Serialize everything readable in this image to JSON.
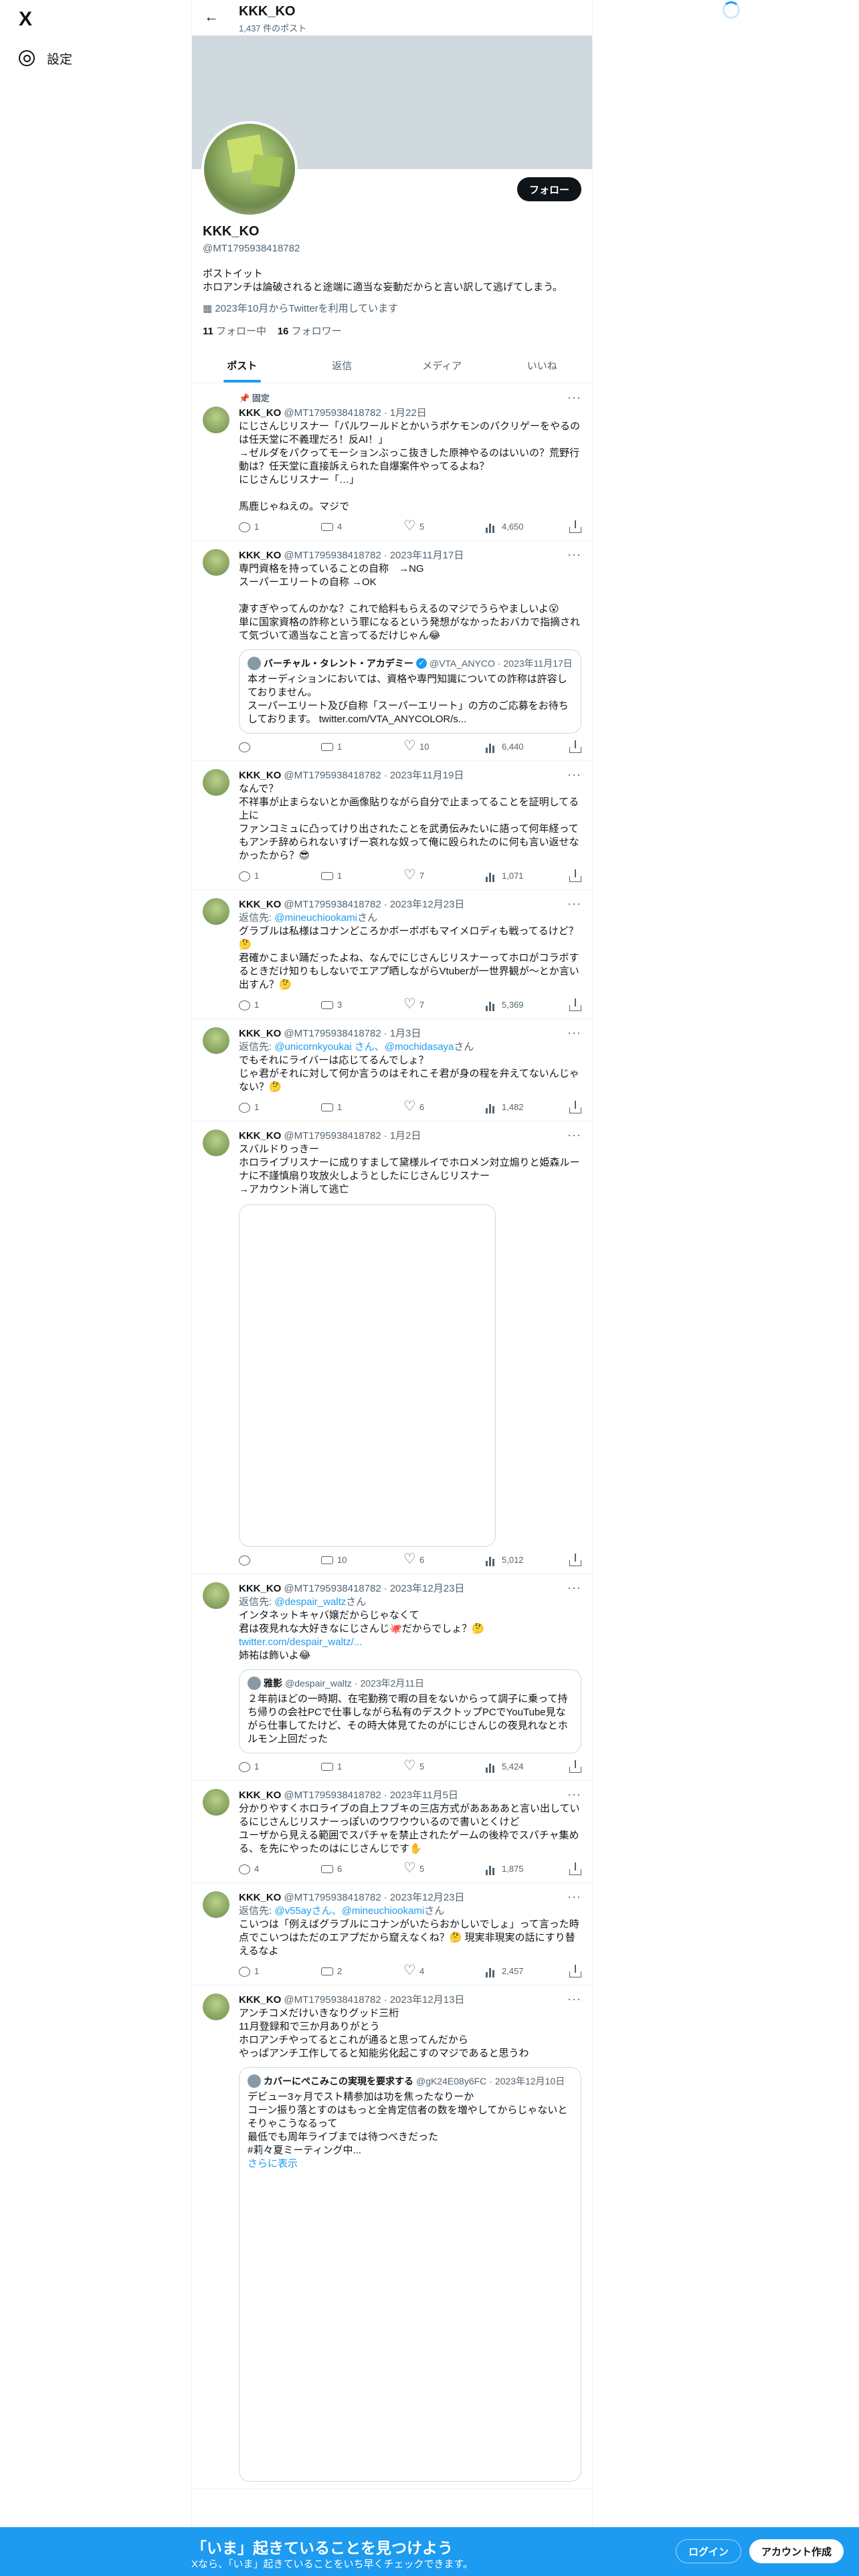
{
  "nav": {
    "logo": "X",
    "settings_label": "設定"
  },
  "header": {
    "name": "KKK_KO",
    "post_count": "1,437 件のポスト"
  },
  "profile": {
    "name": "KKK_KO",
    "handle": "@MT1795938418782",
    "follow_label": "フォロー",
    "bio": "ポストイット\nホロアンチは論破されると途端に適当な妄動だからと言い訳して逃げてしまう。",
    "joined": "2023年10月からTwitterを利用しています",
    "following_count": "11",
    "following_label": "フォロー中",
    "followers_count": "16",
    "followers_label": "フォロワー"
  },
  "tabs": [
    "ポスト",
    "返信",
    "メディア",
    "いいね"
  ],
  "tweets": [
    {
      "pinned": "固定",
      "name": "KKK_KO",
      "handle": "@MT1795938418782",
      "date": "1月22日",
      "text": "にじさんじリスナー「パルワールドとかいうポケモンのパクリゲーをやるのは任天堂に不義理だろ！反AI！」\n→ゼルダをパクってモーションぶっこ抜きした原神やるのはいいの？荒野行動は？任天堂に直接訴えられた自爆案件やってるよね？\nにじさんじリスナー「…」\n\n馬鹿じゃねえの。マジで",
      "replies": "1",
      "reposts": "4",
      "likes": "5",
      "views": "4,650"
    },
    {
      "name": "KKK_KO",
      "handle": "@MT1795938418782",
      "date": "2023年11月17日",
      "text": "専門資格を持っていることの自称　→NG\nスーパーエリートの自称 →OK\n\n凄すぎやってんのかな？これで給料もらえるのマジでうらやましいよ😮\n単に国家資格の詐称という罪になるという発想がなかったおバカで指摘されて気づいて適当なこと言ってるだけじゃん😂",
      "quote": {
        "name": "バーチャル・タレント・アカデミー",
        "handle": "@VTA_ANYCO",
        "date": "2023年11月17日",
        "text": "本オーディションにおいては、資格や専門知識についての詐称は許容しておりません。\nスーパーエリート及び自称「スーパーエリート」の方のご応募をお待ちしております。 twitter.com/VTA_ANYCOLOR/s..."
      },
      "replies": "",
      "reposts": "1",
      "likes": "10",
      "views": "6,440"
    },
    {
      "name": "KKK_KO",
      "handle": "@MT1795938418782",
      "date": "2023年11月19日",
      "text": "なんで？\n不祥事が止まらないとか画像貼りながら自分で止まってることを証明してる上に\nファンコミュに凸ってけり出されたことを武勇伝みたいに語って何年経ってもアンチ辞められないすげー哀れな奴って俺に殴られたのに何も言い返せなかったから？😎",
      "replies": "1",
      "reposts": "1",
      "likes": "7",
      "views": "1,071"
    },
    {
      "name": "KKK_KO",
      "handle": "@MT1795938418782",
      "date": "2023年12月23日",
      "reply_to": "@mineuchiookami",
      "text": "グラブルは私様はコナンどころかボーボボもマイメロディも戦ってるけど？🤔\n君確かこまい踊だったよね、なんでにじさんじリスナーってホロがコラボするときだけ知りもしないでエアプ晒しながらVtuberが一世界観が〜とか言い出すん？🤔",
      "replies": "1",
      "reposts": "3",
      "likes": "7",
      "views": "5,369"
    },
    {
      "name": "KKK_KO",
      "handle": "@MT1795938418782",
      "date": "1月3日",
      "reply_to": "@unicornkyoukai さん、@mochidasaya",
      "text": "でもそれにライバーは応じてるんでしょ？\nじゃ君がそれに対して何か言うのはそれこそ君が身の程を弁えてないんじゃない？🤔",
      "replies": "1",
      "reposts": "1",
      "likes": "6",
      "views": "1,482"
    },
    {
      "name": "KKK_KO",
      "handle": "@MT1795938418782",
      "date": "1月2日",
      "text": "スバルドりっきー\nホロライブリスナーに成りすまして黛様ルイでホロメン対立煽りと姫森ルーナに不謹慎扇り攻放火しようとしたにじさんじリスナー\n→アカウント消して逃亡",
      "media": true,
      "replies": "",
      "reposts": "10",
      "likes": "6",
      "views": "5,012"
    },
    {
      "name": "KKK_KO",
      "handle": "@MT1795938418782",
      "date": "2023年12月23日",
      "reply_to": "@despair_waltz",
      "text": "インタネットキャバ嬢だからじゃなくて\n君は夜見れな大好きなにじさんじ🐙だからでしょ？🤔",
      "link": "twitter.com/despair_waltz/...",
      "text2": "姉祐は飾いよ😂",
      "quote": {
        "name": "雅影",
        "handle": "@despair_waltz",
        "date": "2023年2月11日",
        "text": "２年前ほどの一時期、在宅勤務で暇の目をないからって調子に乗って持ち帰りの会社PCで仕事しながら私有のデスクトップPCでYouTube見ながら仕事してたけど、その時大体見てたのがにじさんじの夜見れなとホルモン上回だった"
      },
      "replies": "1",
      "reposts": "1",
      "likes": "5",
      "views": "5,424"
    },
    {
      "name": "KKK_KO",
      "handle": "@MT1795938418782",
      "date": "2023年11月5日",
      "text": "分かりやすくホロライブの自上フブキの三店方式がああああと言い出しているにじさんじリスナーっぽいのウワウウいるので書いとくけど\nユーザから見える範囲でスパチャを禁止されたゲームの後枠でスパチャ集める、を先にやったのはにじさんじです✋",
      "replies": "4",
      "reposts": "6",
      "likes": "5",
      "views": "1,875"
    },
    {
      "name": "KKK_KO",
      "handle": "@MT1795938418782",
      "date": "2023年12月23日",
      "reply_to": "@v55ayさん、@mineuchiookami",
      "text": "こいつは「例えばグラブルにコナンがいたらおかしいでしょ」って言った時点でこいつはただのエアプだから窟えなくね？🤔 現実非現実の話にすり替えるなよ",
      "replies": "1",
      "reposts": "2",
      "likes": "4",
      "views": "2,457"
    },
    {
      "name": "KKK_KO",
      "handle": "@MT1795938418782",
      "date": "2023年12月13日",
      "text": "アンチコメだけいきなりグッド三桁\n11月登録和で三か月ありがとう\nホロアンチやってるとこれが通ると思ってんだから\nやっぱアンチ工作してると知能劣化起こすのマジであると思うわ",
      "quote": {
        "name": "カバーにぺこみこの実現を要求する",
        "handle": "@gK24E08y6FC",
        "date": "2023年12月10日",
        "text": "デビュー3ヶ月でスト精参加は功を焦ったなりーか\nコーン振り落とすのはもっと全肯定信者の数を増やしてからじゃないとそりゃこうなるって\n最低でも周年ライブまでは待つべきだった\n#莉々夏ミーティング中...",
        "more": "さらに表示"
      },
      "replies": "",
      "reposts": "",
      "likes": "",
      "views": ""
    }
  ],
  "reply_label": "返信先:",
  "reply_suffix": "さん",
  "bottom_bar": {
    "title": "「いま」起きていることを見つけよう",
    "subtitle": "Xなら、「いま」起きていることをいち早くチェックできます。",
    "login": "ログイン",
    "signup": "アカウント作成"
  },
  "icons": [
    "x-logo-icon",
    "gear-icon",
    "back-arrow-icon",
    "reply-icon",
    "repost-icon",
    "like-icon",
    "views-icon",
    "share-icon",
    "more-icon",
    "pin-icon",
    "calendar-icon",
    "verified-icon"
  ]
}
